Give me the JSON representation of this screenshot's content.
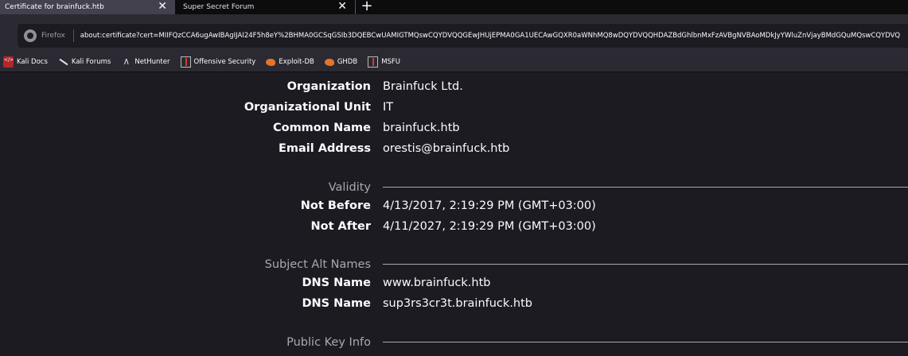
{
  "tabs": [
    {
      "title": "Certificate for brainfuck.htb",
      "active": true
    },
    {
      "title": "Super Secret Forum",
      "active": false
    }
  ],
  "new_tab_label": "+",
  "close_glyph": "✕",
  "urlbar": {
    "identity_label": "Firefox",
    "url": "about:certificate?cert=MIIFQzCCA6ugAwIBAgIJAI24F5h8eY%2BHMA0GCSqGSIb3DQEBCwUAMIGTMQswCQYDVQQGEwJHUjEPMA0GA1UECAwGQXR0aWNhMQ8wDQYDVQQHDAZBdGhlbnMxFzAVBgNVBAoMDkJyYWluZnVjayBMdGQuMQswCQYDVQ"
  },
  "bookmarks": [
    {
      "label": "Kali Docs",
      "icon": "kali-docs-icon"
    },
    {
      "label": "Kali Forums",
      "icon": "kali-dragon-icon"
    },
    {
      "label": "NetHunter",
      "icon": "nethunter-icon"
    },
    {
      "label": "Offensive Security",
      "icon": "offsec-icon"
    },
    {
      "label": "Exploit-DB",
      "icon": "exploit-db-icon"
    },
    {
      "label": "GHDB",
      "icon": "ghdb-icon"
    },
    {
      "label": "MSFU",
      "icon": "msfu-icon"
    }
  ],
  "subject_fields": [
    {
      "label": "Organization",
      "value": "Brainfuck Ltd."
    },
    {
      "label": "Organizational Unit",
      "value": "IT"
    },
    {
      "label": "Common Name",
      "value": "brainfuck.htb"
    },
    {
      "label": "Email Address",
      "value": "orestis@brainfuck.htb"
    }
  ],
  "validity": {
    "title": "Validity",
    "fields": [
      {
        "label": "Not Before",
        "value": "4/13/2017, 2:19:29 PM (GMT+03:00)"
      },
      {
        "label": "Not After",
        "value": "4/11/2027, 2:19:29 PM (GMT+03:00)"
      }
    ]
  },
  "subject_alt_names": {
    "title": "Subject Alt Names",
    "fields": [
      {
        "label": "DNS Name",
        "value": "www.brainfuck.htb"
      },
      {
        "label": "DNS Name",
        "value": "sup3rs3cr3t.brainfuck.htb"
      }
    ]
  },
  "public_key_info": {
    "title": "Public Key Info"
  }
}
